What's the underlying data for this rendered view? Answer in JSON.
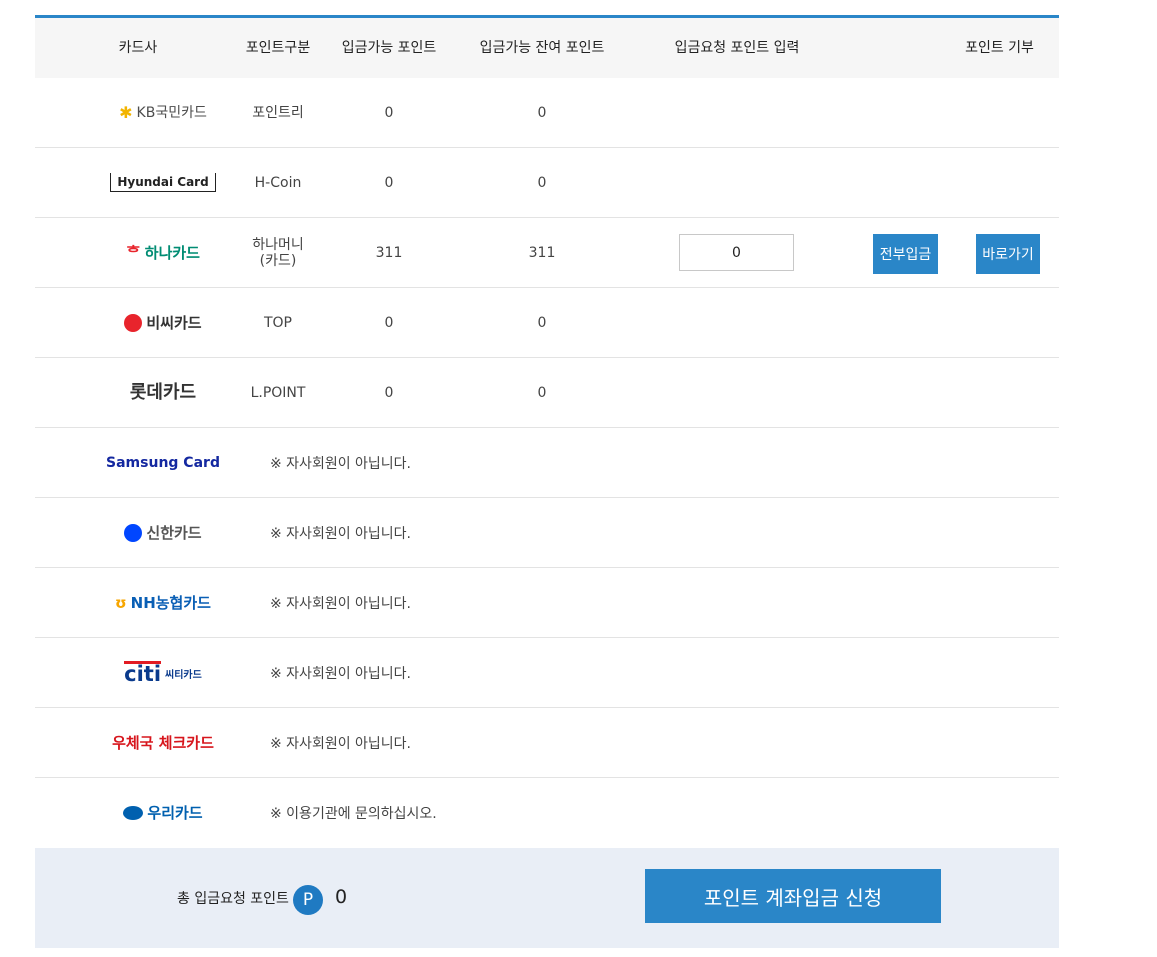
{
  "header": {
    "card": "카드사",
    "type": "포인트구분",
    "available": "입금가능 포인트",
    "remaining": "입금가능 잔여 포인트",
    "request": "입금요청 포인트 입력",
    "donate": "포인트 기부"
  },
  "rows": [
    {
      "logo": "KB국민카드",
      "type": "포인트리",
      "available": "0",
      "remaining": "0",
      "color": "#4d4d4d",
      "mark_color": "#f2b400"
    },
    {
      "logo": "Hyundai Card",
      "type": "H-Coin",
      "available": "0",
      "remaining": "0",
      "color": "#222222"
    },
    {
      "logo": "하나카드",
      "type_line1": "하나머니",
      "type_line2": "(카드)",
      "available": "311",
      "remaining": "311",
      "input_value": "0",
      "all_deposit": "전부입금",
      "go": "바로가기",
      "color": "#008c73"
    },
    {
      "logo": "비씨카드",
      "type": "TOP",
      "available": "0",
      "remaining": "0",
      "color": "#333333",
      "mark_color": "#e8242c"
    },
    {
      "logo": "롯데카드",
      "type": "L.POINT",
      "available": "0",
      "remaining": "0",
      "color": "#333333"
    },
    {
      "logo": "Samsung Card",
      "note": "※ 자사회원이 아닙니다.",
      "color": "#1428a0"
    },
    {
      "logo": "신한카드",
      "note": "※ 자사회원이 아닙니다.",
      "color": "#555555",
      "mark_color": "#0046ff"
    },
    {
      "logo": "NH농협카드",
      "note": "※ 자사회원이 아닙니다.",
      "color": "#0a5fb5",
      "mark_color": "#f7a600"
    },
    {
      "logo": "citi",
      "logo_sub": "씨티카드",
      "note": "※ 자사회원이 아닙니다.",
      "color": "#0a3a8c",
      "mark_color": "#e21b23"
    },
    {
      "logo": "우체국 체크카드",
      "note": "※ 자사회원이 아닙니다.",
      "color": "#d7161d"
    },
    {
      "logo": "우리카드",
      "note": "※ 이용기관에 문의하십시오.",
      "color": "#0060af",
      "mark_color": "#0060af"
    }
  ],
  "footer": {
    "total_label": "총 입금요청 포인트",
    "badge": "P",
    "total_value": "0",
    "apply": "포인트 계좌입금 신청"
  },
  "colors": {
    "accent": "#2a86c8",
    "footer_bg": "#e9eef6",
    "header_bg": "#f6f6f6"
  }
}
